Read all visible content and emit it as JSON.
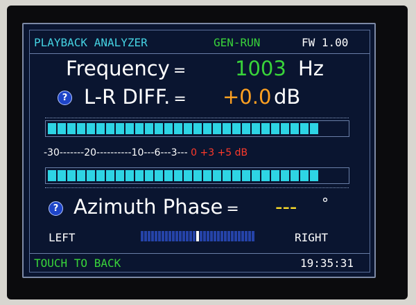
{
  "header": {
    "title": "PLAYBACK ANALYZER",
    "mode": "GEN-RUN",
    "firmware": "FW 1.00"
  },
  "frequency": {
    "label": "Frequency",
    "eq": "=",
    "value": "1003",
    "unit": "Hz"
  },
  "lr_diff": {
    "help": "?",
    "label": "L-R DIFF.",
    "eq": "=",
    "value": "+0.0",
    "unit": "dB"
  },
  "level_meter": {
    "scale_white": "-30-------20----------10---6---3---",
    "scale_red": "0 +3 +5 dB",
    "top_segments_lit": 28,
    "bottom_segments_lit": 28
  },
  "azimuth": {
    "help": "?",
    "label": "Azimuth Phase",
    "eq": "=",
    "value": "---",
    "unit": "°",
    "left_label": "LEFT",
    "right_label": "RIGHT",
    "indicator_position": 0.5
  },
  "footer": {
    "touch_back": "TOUCH TO BACK",
    "time": "19:35:31"
  },
  "colors": {
    "background": "#0a1530",
    "title_cyan": "#45d2e2",
    "green": "#39d43a",
    "orange": "#ffa021",
    "yellow": "#ffe02a",
    "red": "#ff3a2a",
    "meter_cyan": "#2ed4e4",
    "azimuth_blue": "#2543a8"
  }
}
